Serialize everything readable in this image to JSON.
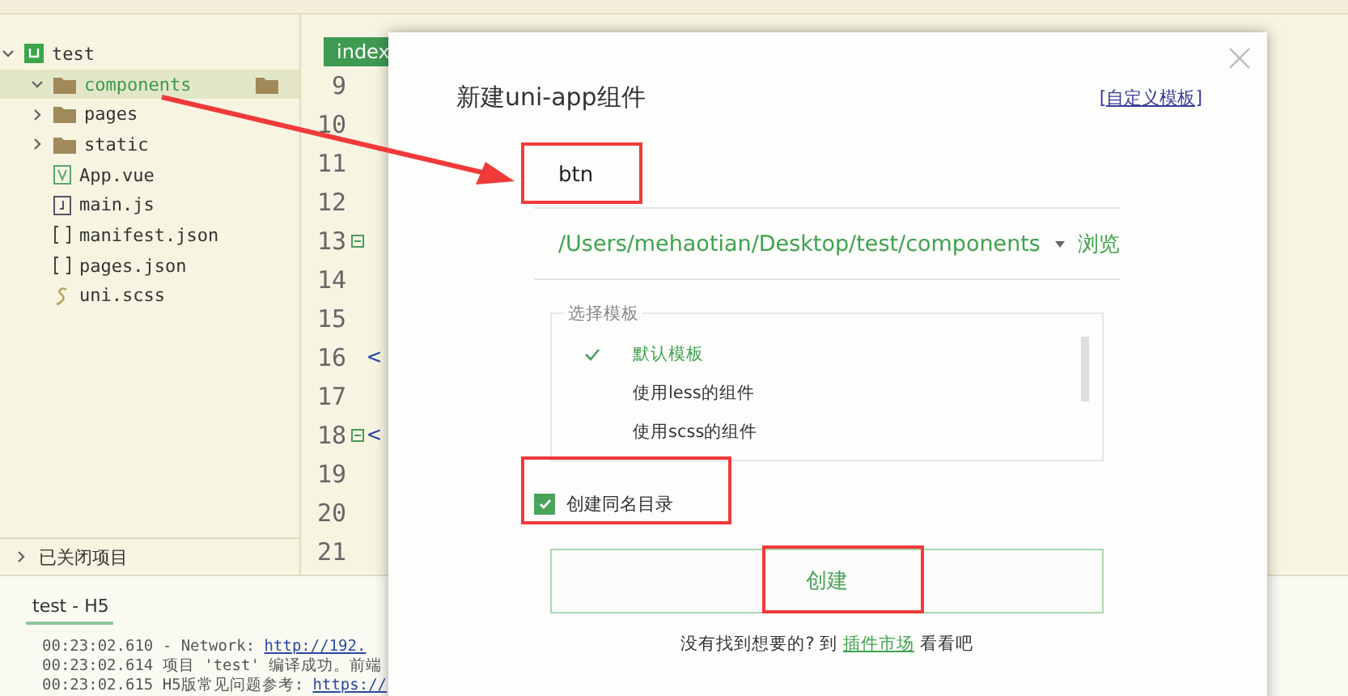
{
  "sidebar": {
    "project": {
      "name": "test",
      "expanded": true,
      "children": [
        {
          "name": "components",
          "kind": "folder",
          "expanded": true,
          "selected": true
        },
        {
          "name": "pages",
          "kind": "folder",
          "expanded": false,
          "selected": false
        },
        {
          "name": "static",
          "kind": "folder",
          "expanded": false,
          "selected": false
        },
        {
          "name": "App.vue",
          "kind": "vue",
          "selected": false
        },
        {
          "name": "main.js",
          "kind": "js",
          "selected": false
        },
        {
          "name": "manifest.json",
          "kind": "json",
          "selected": false
        },
        {
          "name": "pages.json",
          "kind": "json",
          "selected": false
        },
        {
          "name": "uni.scss",
          "kind": "scss",
          "selected": false
        }
      ]
    },
    "closed_projects": {
      "label": "已关闭项目",
      "expanded": false
    }
  },
  "editor": {
    "tab": {
      "label": "index",
      "selected": true
    },
    "lines": [
      {
        "number": "9",
        "fold": false
      },
      {
        "number": "10",
        "fold": false
      },
      {
        "number": "11",
        "fold": false
      },
      {
        "number": "12",
        "fold": false
      },
      {
        "number": "13",
        "fold": true
      },
      {
        "number": "14",
        "fold": false
      },
      {
        "number": "15",
        "fold": false
      },
      {
        "number": "16",
        "fold": false,
        "code": "<"
      },
      {
        "number": "17",
        "fold": false
      },
      {
        "number": "18",
        "fold": true,
        "code": "<"
      },
      {
        "number": "19",
        "fold": false
      },
      {
        "number": "20",
        "fold": false
      },
      {
        "number": "21",
        "fold": false
      }
    ]
  },
  "console": {
    "tab": "test - H5",
    "lines": [
      {
        "time": "00:23:02.610",
        "message": "  - Network: ",
        "link": "http://192."
      },
      {
        "time": "00:23:02.614",
        "message": "项目 'test' 编译成功。前端"
      },
      {
        "time": "00:23:02.615",
        "message": "H5版常见问题参考: ",
        "link": "https://"
      }
    ]
  },
  "dialog": {
    "title": "新建uni-app组件",
    "custom_template_link": "[自定义模板]",
    "name_input": {
      "value": "btn"
    },
    "path": {
      "value": "/Users/mehaotian/Desktop/test/components",
      "browse": "浏览"
    },
    "templates": {
      "legend": "选择模板",
      "items": [
        {
          "label": "默认模板",
          "selected": true
        },
        {
          "label": "使用less的组件",
          "selected": false
        },
        {
          "label": "使用scss的组件",
          "selected": false
        }
      ]
    },
    "create_dir_checkbox": {
      "label": "创建同名目录",
      "checked": true
    },
    "create_button": "创建",
    "footer": {
      "text": "没有找到想要的? 到",
      "link": "插件市场",
      "suffix": "看看吧"
    }
  }
}
